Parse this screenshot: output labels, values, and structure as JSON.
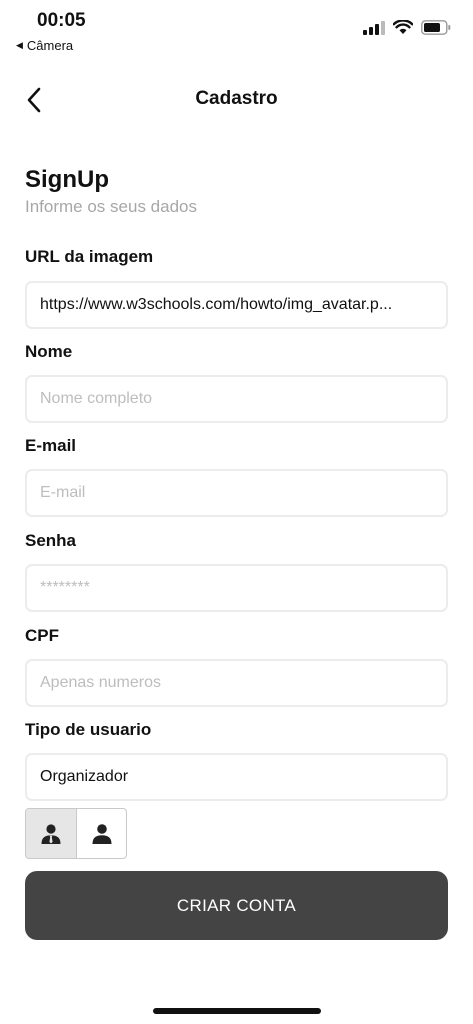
{
  "status_bar": {
    "time": "00:05",
    "back_app": "Câmera"
  },
  "nav": {
    "title": "Cadastro"
  },
  "header": {
    "title": "SignUp",
    "subtitle": "Informe os seus dados"
  },
  "form": {
    "image_url": {
      "label": "URL da imagem",
      "value": "https://www.w3schools.com/howto/img_avatar.p..."
    },
    "name": {
      "label": "Nome",
      "placeholder": "Nome completo"
    },
    "email": {
      "label": "E-mail",
      "placeholder": "E-mail"
    },
    "password": {
      "label": "Senha",
      "placeholder": "********"
    },
    "cpf": {
      "label": "CPF",
      "placeholder": "Apenas numeros"
    },
    "user_type": {
      "label": "Tipo de usuario",
      "value": "Organizador"
    }
  },
  "user_type_toggle": {
    "options": [
      "organizer-icon",
      "user-icon"
    ],
    "selected": 0
  },
  "submit": {
    "label": "CRIAR CONTA"
  },
  "colors": {
    "button_bg": "#444444",
    "field_border": "#ececec",
    "muted_text": "#a7a7a7",
    "placeholder": "#bdbdbd",
    "toggle_active": "#e6e6e6"
  }
}
